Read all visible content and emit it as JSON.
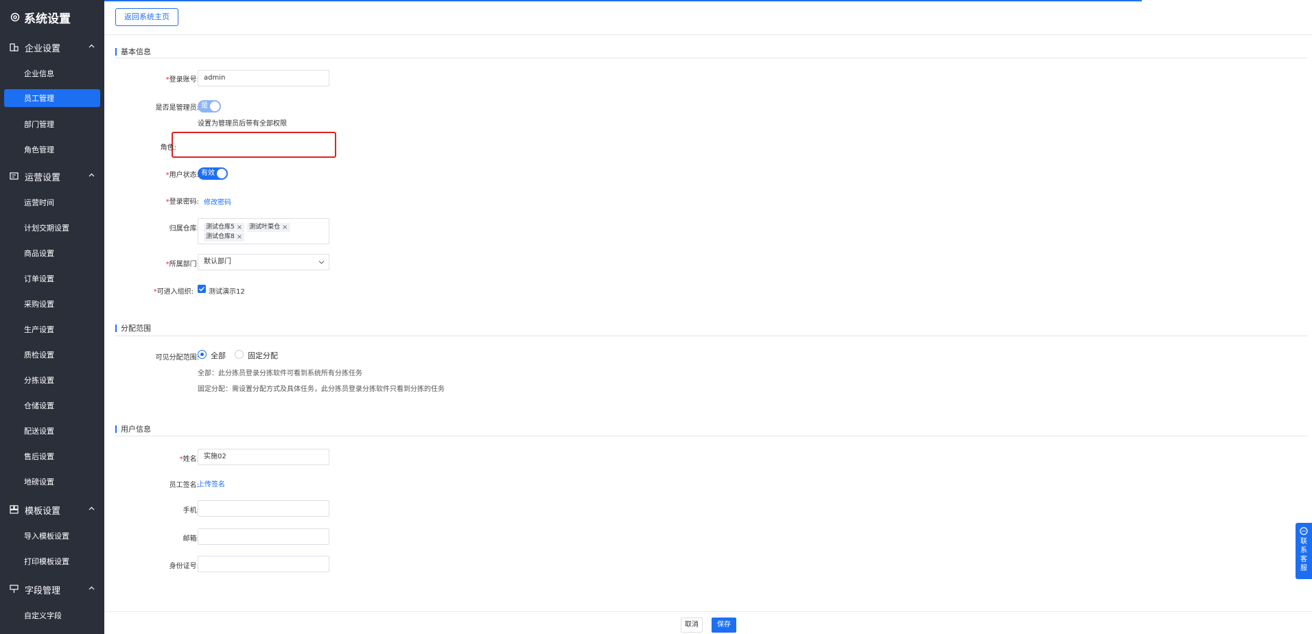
{
  "sidebar": {
    "title": "系统设置",
    "groups": [
      {
        "label": "企业设置",
        "items": [
          "企业信息",
          "员工管理",
          "部门管理",
          "角色管理"
        ]
      },
      {
        "label": "运营设置",
        "items": [
          "运营时间",
          "计划交期设置",
          "商品设置",
          "订单设置",
          "采购设置",
          "生产设置",
          "质检设置",
          "分拣设置",
          "仓储设置",
          "配送设置",
          "售后设置",
          "地磅设置"
        ]
      },
      {
        "label": "模板设置",
        "items": [
          "导入模板设置",
          "打印模板设置"
        ]
      },
      {
        "label": "字段管理",
        "items": [
          "自定义字段"
        ]
      }
    ],
    "active_item": "员工管理"
  },
  "header": {
    "back_label": "返回系统主页"
  },
  "basic": {
    "title": "基本信息",
    "account_label": "登录账号:",
    "account_value": "admin",
    "admin_label": "是否是管理员:",
    "admin_switch": "是",
    "admin_hint": "设置为管理员后带有全部权限",
    "role_label": "角色:",
    "role_value": "",
    "status_label": "用户状态:",
    "status_switch": "有效",
    "password_label": "登录密码:",
    "password_link": "修改密码",
    "warehouse_label": "归属仓库:",
    "warehouse_tags": [
      "测试仓库5",
      "测试叶菜仓",
      "测试仓库8"
    ],
    "dept_label": "所属部门:",
    "dept_value": "默认部门",
    "org_label": "可进入组织:",
    "org_value": "测试演示12"
  },
  "scope": {
    "title": "分配范围",
    "label": "可见分配范围:",
    "opt_all": "全部",
    "opt_fixed": "固定分配",
    "hint_all": "全部：此分拣员登录分拣软件可看到系统所有分拣任务",
    "hint_fixed": "固定分配：需设置分配方式及具体任务，此分拣员登录分拣软件只看到分拣的任务"
  },
  "user": {
    "title": "用户信息",
    "name_label": "姓名:",
    "name_value": "实施02",
    "sign_label": "员工签名:",
    "sign_link": "上传签名",
    "phone_label": "手机:",
    "email_label": "邮箱:",
    "id_label": "身份证号:"
  },
  "footer": {
    "cancel": "取消",
    "save": "保存"
  },
  "float": {
    "chars": [
      "联",
      "系",
      "客",
      "服"
    ]
  }
}
